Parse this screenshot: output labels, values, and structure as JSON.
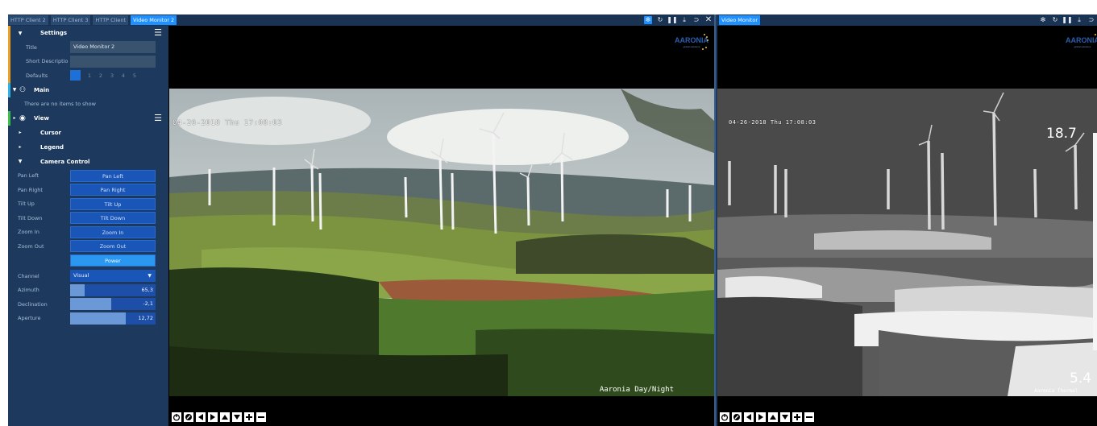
{
  "left_pane": {
    "tabs": [
      {
        "label": "HTTP Client 2",
        "active": false
      },
      {
        "label": "HTTP Client 3",
        "active": false
      },
      {
        "label": "HTTP Client",
        "active": false
      },
      {
        "label": "Video Monitor 2",
        "active": true
      }
    ],
    "toolbar_icons": [
      "gear-icon",
      "refresh-icon",
      "pause-icon",
      "download-icon",
      "pin-icon",
      "close-icon"
    ]
  },
  "right_pane": {
    "tabs": [
      {
        "label": "Video Monitor",
        "active": true
      }
    ],
    "toolbar_icons": [
      "gear-icon",
      "refresh-icon",
      "pause-icon",
      "download-icon",
      "pin-icon"
    ]
  },
  "settings": {
    "header": "Settings",
    "title_label": "Title",
    "title_value": "Video Monitor 2",
    "short_desc_label": "Short Descriptio",
    "short_desc_value": "",
    "defaults_label": "Defaults",
    "defaults_numbers": [
      "1",
      "2",
      "3",
      "4",
      "5"
    ]
  },
  "main_section": {
    "header": "Main",
    "empty_text": "There are no items to show"
  },
  "view_section": {
    "header": "View",
    "cursor": "Cursor",
    "legend": "Legend",
    "camera_control": "Camera Control"
  },
  "camera": {
    "pan_left_label": "Pan Left",
    "pan_left_btn": "Pan Left",
    "pan_right_label": "Pan Right",
    "pan_right_btn": "Pan Right",
    "tilt_up_label": "Tilt Up",
    "tilt_up_btn": "Tilt Up",
    "tilt_down_label": "Tilt Down",
    "tilt_down_btn": "Tilt Down",
    "zoom_in_label": "Zoom In",
    "zoom_in_btn": "Zoom In",
    "zoom_out_label": "Zoom Out",
    "zoom_out_btn": "Zoom Out",
    "power_btn": "Power",
    "channel_label": "Channel",
    "channel_value": "Visual",
    "azimuth_label": "Azimuth",
    "azimuth_value": "65,3",
    "azimuth_fraction": 0.17,
    "declination_label": "Declination",
    "declination_value": "-2,1",
    "declination_fraction": 0.48,
    "aperture_label": "Aperture",
    "aperture_value": "12,72",
    "aperture_fraction": 0.65
  },
  "video_left": {
    "date_overlay": "04-26-2018 Thu 17:08:03",
    "caption": "Aaronia Day/Night"
  },
  "video_right": {
    "date_overlay": "04-26-2018 Thu 17:08:03",
    "caption": "Aaronia Thermal",
    "temp_max": "18.7",
    "temp_min": "5.4"
  },
  "colors": {
    "accent": "#1e90ff",
    "panel_bg": "#1d3a5e",
    "button_bg": "#1a55b8"
  }
}
